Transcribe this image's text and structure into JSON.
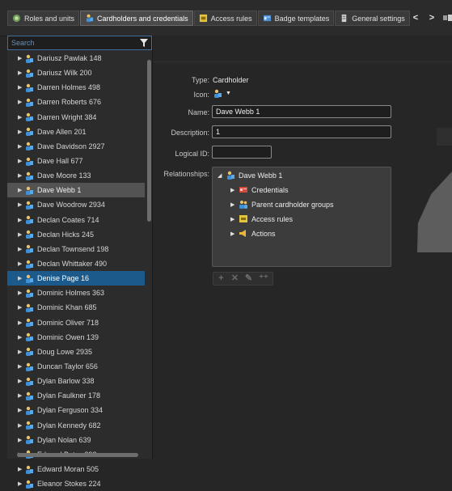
{
  "toolbar": {
    "tabs": [
      {
        "label": "Roles and units",
        "icon": "roles-icon",
        "active": false
      },
      {
        "label": "Cardholders and credentials",
        "icon": "cardholder-icon",
        "active": true
      },
      {
        "label": "Access rules",
        "icon": "access-rules-icon",
        "active": false
      },
      {
        "label": "Badge templates",
        "icon": "badge-template-icon",
        "active": false
      },
      {
        "label": "General settings",
        "icon": "general-settings-icon",
        "active": false
      }
    ],
    "nav_prev": "<",
    "nav_next": ">"
  },
  "search": {
    "placeholder": "Search",
    "value": ""
  },
  "cardholders": [
    "Dariusz Pawlak 148",
    "Dariusz Wilk 200",
    "Darren Holmes 498",
    "Darren Roberts 676",
    "Darren Wright 384",
    "Dave Allen 201",
    "Dave Davidson 2927",
    "Dave Hall 677",
    "Dave Moore 133",
    "Dave Webb 1",
    "Dave Woodrow 2934",
    "Declan Coates 714",
    "Declan Hicks 245",
    "Declan Townsend 198",
    "Declan Whittaker 490",
    "Denise Page 16",
    "Dominic Holmes 363",
    "Dominic Khan 685",
    "Dominic Oliver 718",
    "Dominic Owen 139",
    "Doug Lowe 2935",
    "Duncan Taylor 656",
    "Dylan Barlow 338",
    "Dylan Faulkner 178",
    "Dylan Ferguson 334",
    "Dylan Kennedy 682",
    "Dylan Nolan 639",
    "Edward Bates 392",
    "Edward Moran 505",
    "Eleanor Stokes 224"
  ],
  "highlighted_cardholder": "Dave Webb 1",
  "selected_cardholder": "Denise Page 16",
  "details": {
    "type_label": "Type:",
    "type_value": "Cardholder",
    "icon_label": "Icon:",
    "name_label": "Name:",
    "name_value": "Dave Webb 1",
    "description_label": "Description:",
    "description_value": "1",
    "logical_id_label": "Logical ID:",
    "logical_id_value": "",
    "relationships_label": "Relationships:"
  },
  "relationships": {
    "root": "Dave Webb 1",
    "children": [
      {
        "label": "Credentials",
        "icon": "credentials-icon"
      },
      {
        "label": "Parent cardholder groups",
        "icon": "cardholder-group-icon"
      },
      {
        "label": "Access rules",
        "icon": "access-rules-icon"
      },
      {
        "label": "Actions",
        "icon": "actions-icon"
      }
    ]
  },
  "relationship_buttons": [
    "add",
    "remove",
    "edit",
    "add-multiple"
  ],
  "colors": {
    "selection": "#1c5a8c",
    "highlight": "#535353",
    "background": "#262626"
  }
}
